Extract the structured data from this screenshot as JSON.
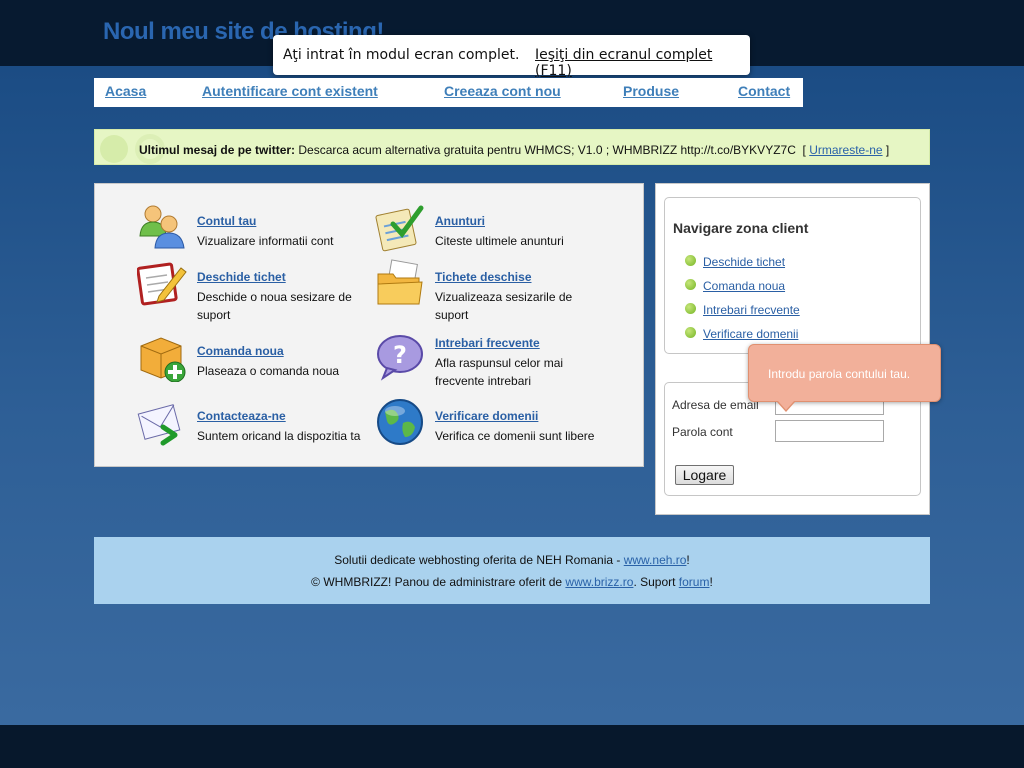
{
  "header": {
    "site_title": "Noul meu site de hosting!"
  },
  "fullscreen_notice": {
    "message": "Aţi intrat în modul ecran complet.",
    "exit_link": "Ieşiţi din ecranul complet (F11)"
  },
  "nav": {
    "items": [
      {
        "label": "Acasa"
      },
      {
        "label": "Autentificare cont existent"
      },
      {
        "label": "Creeaza cont nou"
      },
      {
        "label": "Produse"
      },
      {
        "label": "Contact"
      }
    ]
  },
  "twitter": {
    "prefix": "Ultimul mesaj de pe twitter:",
    "message": " Descarca acum alternativa gratuita pentru WHMCS; V1.0 ; WHMBRIZZ http://t.co/BYKVYZ7C",
    "bracket_open": "  [ ",
    "follow_link": "Urmareste-ne",
    "bracket_close": " ]"
  },
  "features": [
    {
      "title": "Contul tau",
      "desc": "Vizualizare informatii cont",
      "icon": "users-icon"
    },
    {
      "title": "Anunturi",
      "desc": "Citeste ultimele anunturi",
      "icon": "clipboard-check-icon"
    },
    {
      "title": "Deschide tichet",
      "desc": "Deschide o noua sesizare de suport",
      "icon": "edit-pencil-icon"
    },
    {
      "title": "Tichete deschise",
      "desc": "Vizualizeaza sesizarile de suport",
      "icon": "folder-icon"
    },
    {
      "title": "Comanda noua",
      "desc": "Plaseaza o comanda noua",
      "icon": "box-add-icon"
    },
    {
      "title": "Intrebari frecvente",
      "desc": "Afla raspunsul celor mai frecvente intrebari",
      "icon": "question-bubble-icon"
    },
    {
      "title": "Contacteaza-ne",
      "desc": "Suntem oricand la dispozitia ta",
      "icon": "envelope-arrow-icon"
    },
    {
      "title": "Verificare domenii",
      "desc": "Verifica ce domenii sunt libere",
      "icon": "globe-icon"
    }
  ],
  "client_nav": {
    "heading": "Navigare zona client",
    "items": [
      {
        "label": "Deschide tichet"
      },
      {
        "label": "Comanda noua"
      },
      {
        "label": "Intrebari frecvente"
      },
      {
        "label": "Verificare domenii"
      }
    ]
  },
  "login": {
    "email_label": "Adresa de email",
    "email_value": "",
    "password_label": "Parola cont",
    "password_value": "",
    "button": "Logare"
  },
  "tooltip": {
    "text": "Introdu parola contului tau."
  },
  "footer": {
    "line1_text": "Solutii dedicate webhosting oferita de NEH Romania - ",
    "line1_link": "www.neh.ro",
    "line1_end": "!",
    "line2_text": "© WHMBRIZZ! Panou de administrare oferit de ",
    "line2_link": "www.brizz.ro",
    "line2_mid": ". Suport ",
    "line2_link2": "forum",
    "line2_end": "!"
  },
  "colors": {
    "link": "#2a5fa4",
    "nav_link": "#3f7fb9",
    "twitter_bg": "#e6f6c4",
    "footer_bg": "#aad2ee",
    "tooltip_bg": "#f2b09a",
    "page_bg": "#2e5f96"
  }
}
